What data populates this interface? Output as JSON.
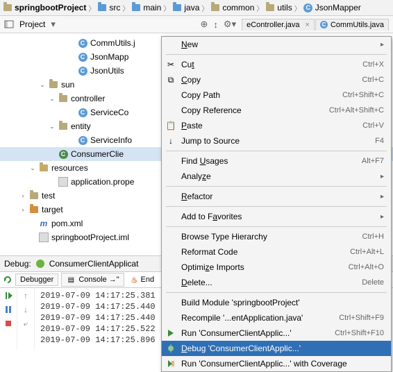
{
  "breadcrumb": [
    {
      "icon": "folder",
      "label": "springbootProject",
      "bold": true
    },
    {
      "icon": "folder-blue",
      "label": "src"
    },
    {
      "icon": "folder-blue",
      "label": "main"
    },
    {
      "icon": "folder-blue",
      "label": "java"
    },
    {
      "icon": "folder",
      "label": "common"
    },
    {
      "icon": "folder",
      "label": "utils"
    },
    {
      "icon": "class",
      "label": "JsonMapper"
    }
  ],
  "tool": {
    "project": "Project"
  },
  "editor_tabs": [
    {
      "label": "eController.java"
    },
    {
      "label": "CommUtils.java"
    }
  ],
  "tree": [
    {
      "indent": 7,
      "icon": "class",
      "label": "CommUtils.j"
    },
    {
      "indent": 7,
      "icon": "class",
      "label": "JsonMapp"
    },
    {
      "indent": 7,
      "icon": "class",
      "label": "JsonUtils"
    },
    {
      "indent": 4,
      "tw": "v",
      "icon": "folder",
      "label": "sun"
    },
    {
      "indent": 5,
      "tw": "v",
      "icon": "folder",
      "label": "controller"
    },
    {
      "indent": 7,
      "icon": "class",
      "label": "ServiceCo"
    },
    {
      "indent": 5,
      "tw": "v",
      "icon": "folder",
      "label": "entity"
    },
    {
      "indent": 7,
      "icon": "class",
      "label": "ServiceInfo"
    },
    {
      "indent": 5,
      "icon": "class-g",
      "label": "ConsumerClie",
      "sel": true
    },
    {
      "indent": 3,
      "tw": "v",
      "icon": "folder-res",
      "label": "resources"
    },
    {
      "indent": 5,
      "icon": "file",
      "label": "application.prope"
    },
    {
      "indent": 2,
      "tw": ">",
      "icon": "folder",
      "label": "test"
    },
    {
      "indent": 2,
      "tw": ">",
      "icon": "folder-orange",
      "label": "target"
    },
    {
      "indent": 3,
      "icon": "maven",
      "label": "pom.xml"
    },
    {
      "indent": 3,
      "icon": "file",
      "label": "springbootProject.iml"
    }
  ],
  "ctx": {
    "new": "New",
    "cut": {
      "l": "Cut",
      "s": "Ctrl+X"
    },
    "copy": {
      "l": "Copy",
      "s": "Ctrl+C"
    },
    "copypath": {
      "l": "Copy Path",
      "s": "Ctrl+Shift+C"
    },
    "copyref": {
      "l": "Copy Reference",
      "s": "Ctrl+Alt+Shift+C"
    },
    "paste": {
      "l": "Paste",
      "s": "Ctrl+V"
    },
    "jump": {
      "l": "Jump to Source",
      "s": "F4"
    },
    "findu": {
      "l": "Find Usages",
      "s": "Alt+F7"
    },
    "analyze": "Analyze",
    "refactor": "Refactor",
    "fav": "Add to Favorites",
    "bth": {
      "l": "Browse Type Hierarchy",
      "s": "Ctrl+H"
    },
    "refmt": {
      "l": "Reformat Code",
      "s": "Ctrl+Alt+L"
    },
    "optim": {
      "l": "Optimize Imports",
      "s": "Ctrl+Alt+O"
    },
    "del": {
      "l": "Delete...",
      "s": "Delete"
    },
    "build": "Build Module 'springbootProject'",
    "recomp": {
      "l": "Recompile '...entApplication.java'",
      "s": "Ctrl+Shift+F9"
    },
    "run": {
      "l": "Run 'ConsumerClientApplic...'",
      "s": "Ctrl+Shift+F10"
    },
    "debug": "Debug 'ConsumerClientApplic...'",
    "cov": "Run 'ConsumerClientApplic...' with Coverage"
  },
  "dbg": {
    "title": "Debug:",
    "config": "ConsumerClientApplicat",
    "tab_debugger": "Debugger",
    "tab_console": "Console →\"",
    "tab_end": "End"
  },
  "log": [
    "2019-07-09 14:17:25.381",
    "2019-07-09 14:17:25.440",
    "2019-07-09 14:17:25.440",
    "2019-07-09 14:17:25.522",
    "2019-07-09 14:17:25.896"
  ]
}
